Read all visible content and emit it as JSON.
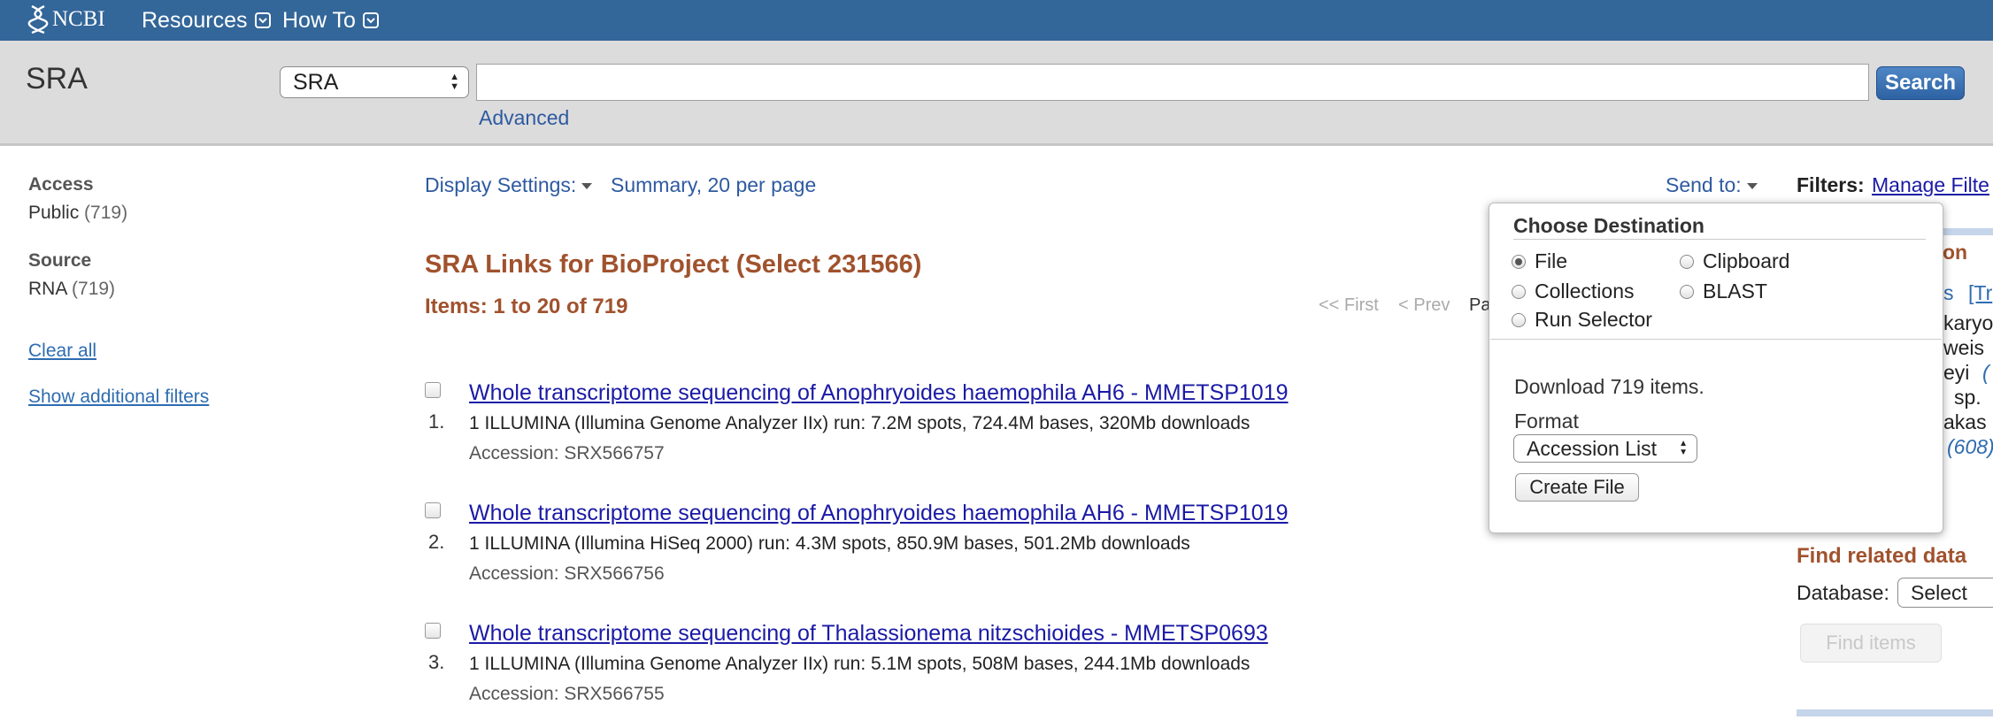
{
  "topbar": {
    "logo_text": "NCBI",
    "nav": [
      {
        "label": "Resources"
      },
      {
        "label": "How To"
      }
    ]
  },
  "search": {
    "db_title": "SRA",
    "db_select_value": "SRA",
    "query_value": "",
    "button_label": "Search",
    "advanced_label": "Advanced"
  },
  "sidebar": {
    "groups": [
      {
        "heading": "Access",
        "item": "Public",
        "count": "(719)"
      },
      {
        "heading": "Source",
        "item": "RNA",
        "count": "(719)"
      }
    ],
    "clear_all": "Clear all",
    "show_filters": "Show additional filters"
  },
  "main": {
    "display_settings_label": "Display Settings:",
    "display_settings_value": "Summary, 20 per page",
    "title": "SRA Links for BioProject (Select 231566)",
    "items_count": "Items: 1 to 20 of 719",
    "pager": {
      "first": "<< First",
      "prev": "< Prev",
      "page_fragment": "Pa"
    },
    "results": [
      {
        "num": "1.",
        "title": "Whole transcriptome sequencing of Anophryoides haemophila AH6 - MMETSP1019",
        "desc": "1 ILLUMINA (Illumina Genome Analyzer IIx) run: 7.2M spots, 724.4M bases, 320Mb downloads",
        "accession": "Accession: SRX566757"
      },
      {
        "num": "2.",
        "title": "Whole transcriptome sequencing of Anophryoides haemophila AH6 - MMETSP1019",
        "desc": "1 ILLUMINA (Illumina HiSeq 2000) run: 4.3M spots, 850.9M bases, 501.2Mb downloads",
        "accession": "Accession: SRX566756"
      },
      {
        "num": "3.",
        "title": "Whole transcriptome sequencing of Thalassionema nitzschioides - MMETSP0693",
        "desc": "1 ILLUMINA (Illumina Genome Analyzer IIx) run: 5.1M spots, 508M bases, 244.1Mb downloads",
        "accession": "Accession: SRX566755"
      }
    ]
  },
  "send_to": {
    "label": "Send to:",
    "filters_label": "Filters:",
    "manage_filters": "Manage Filte",
    "popup": {
      "title": "Choose Destination",
      "options": [
        {
          "label": "File",
          "selected": true
        },
        {
          "label": "Clipboard",
          "selected": false
        },
        {
          "label": "Collections",
          "selected": false
        },
        {
          "label": "BLAST",
          "selected": false
        },
        {
          "label": "Run Selector",
          "selected": false
        }
      ],
      "download_text": "Download 719 items.",
      "format_label": "Format",
      "format_value": "Accession List",
      "create_button": "Create File"
    }
  },
  "right_column": {
    "fragments": [
      "on",
      "s",
      "[Tr",
      "karyo",
      "weis",
      "eyi",
      "(",
      "sp.",
      "akas",
      "(608)"
    ],
    "find_related_title": "Find related data",
    "database_label": "Database:",
    "database_value": "Select",
    "find_items_button": "Find items"
  }
}
